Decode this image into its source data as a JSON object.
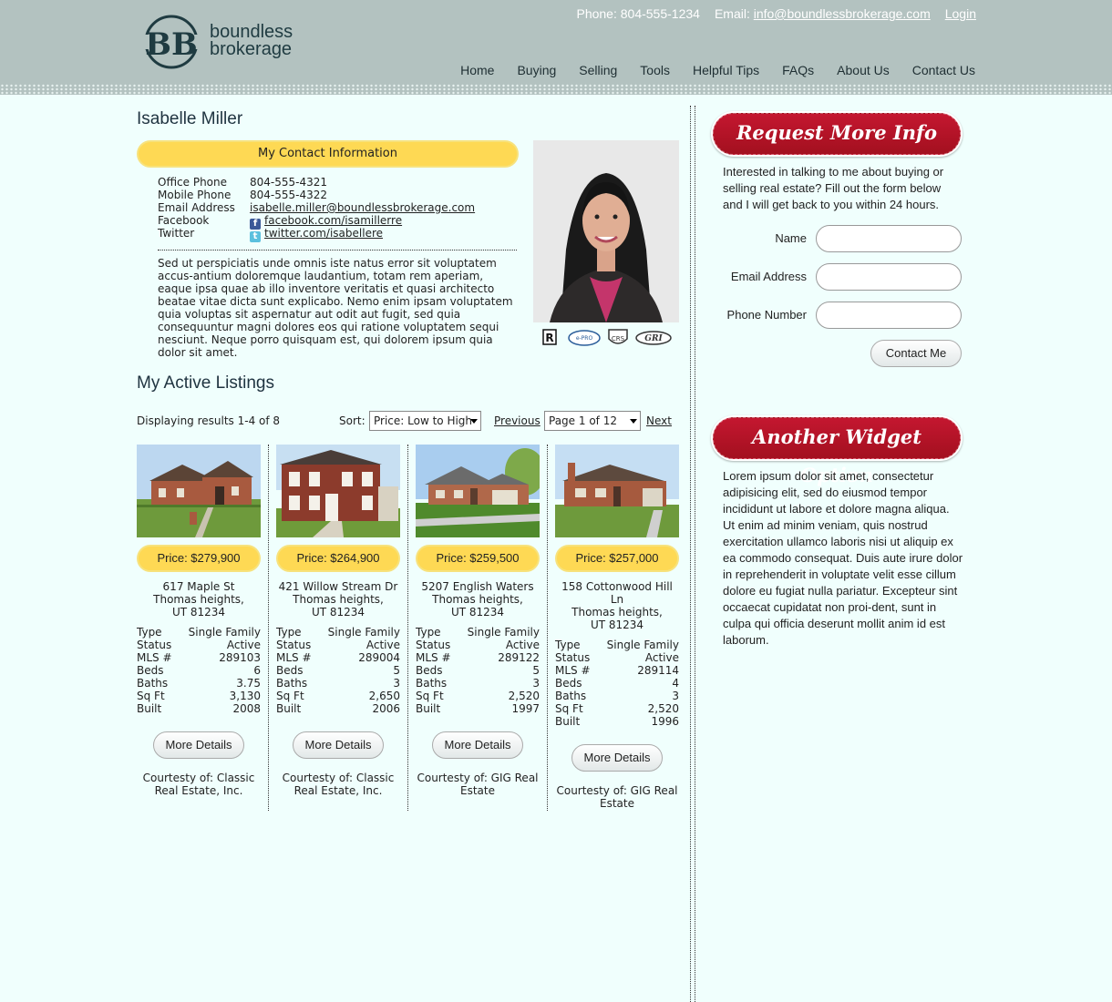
{
  "header": {
    "logo_text_line1": "boundless",
    "logo_text_line2": "brokerage",
    "logo_letters": "BB",
    "phone_label": "Phone:",
    "phone": "804-555-1234",
    "email_label": "Email:",
    "email": "info@boundlessbrokerage.com",
    "login": "Login",
    "nav": [
      "Home",
      "Buying",
      "Selling",
      "Tools",
      "Helpful Tips",
      "FAQs",
      "About Us",
      "Contact Us"
    ]
  },
  "agent": {
    "name": "Isabelle Miller",
    "contact_heading": "My Contact Information",
    "contact": [
      {
        "label": "Office Phone",
        "value": "804-555-4321"
      },
      {
        "label": "Mobile Phone",
        "value": "804-555-4322"
      },
      {
        "label": "Email Address",
        "value": "isabelle.miller@boundlessbrokerage.com"
      },
      {
        "label": "Facebook",
        "value": "facebook.com/isamillerre"
      },
      {
        "label": "Twitter",
        "value": "twitter.com/isabellere"
      }
    ],
    "bio": "Sed ut perspiciatis unde omnis iste natus error sit voluptatem accus-antium doloremque laudantium, totam rem aperiam, eaque ipsa quae ab illo inventore veritatis et quasi architecto beatae vitae dicta sunt explicabo. Nemo enim ipsam voluptatem quia voluptas sit aspernatur aut odit aut fugit, sed quia consequuntur magni dolores eos qui ratione voluptatem sequi nesciunt. Neque porro quisquam est, qui dolorem ipsum quia dolor sit amet.",
    "badges": [
      "R",
      "e-PRO",
      "CRS",
      "GRI"
    ]
  },
  "listings": {
    "title": "My Active Listings",
    "results_text": "Displaying results 1-4 of 8",
    "sort_label": "Sort:",
    "sort_value": "Price: Low to High",
    "previous": "Previous",
    "page_value": "Page 1 of 12",
    "next": "Next",
    "details_label": "More Details",
    "spec_labels": [
      "Type",
      "Status",
      "MLS #",
      "Beds",
      "Baths",
      "Sq Ft",
      "Built"
    ],
    "items": [
      {
        "price": "Price: $279,900",
        "street": "617 Maple St",
        "city": "Thomas heights,",
        "zip": "UT 81234",
        "specs": [
          "Single Family",
          "Active",
          "289103",
          "6",
          "3.75",
          "3,130",
          "2008"
        ],
        "courtesy": "Courtesty of: Classic Real Estate, Inc."
      },
      {
        "price": "Price: $264,900",
        "street": "421 Willow Stream Dr",
        "city": "Thomas heights,",
        "zip": "UT 81234",
        "specs": [
          "Single Family",
          "Active",
          "289004",
          "5",
          "3",
          "2,650",
          "2006"
        ],
        "courtesy": "Courtesty of: Classic Real Estate, Inc."
      },
      {
        "price": "Price: $259,500",
        "street": "5207 English Waters",
        "city": "Thomas heights,",
        "zip": "UT 81234",
        "specs": [
          "Single Family",
          "Active",
          "289122",
          "5",
          "3",
          "2,520",
          "1997"
        ],
        "courtesy": "Courtesty of: GIG Real Estate"
      },
      {
        "price": "Price: $257,000",
        "street": "158 Cottonwood Hill Ln",
        "city": "Thomas heights,",
        "zip": "UT 81234",
        "specs": [
          "Single Family",
          "Active",
          "289114",
          "4",
          "3",
          "2,520",
          "1996"
        ],
        "courtesy": "Courtesty of: GIG Real Estate"
      }
    ]
  },
  "sidebar": {
    "widget1_title": "Request More Info",
    "widget1_text": "Interested in talking to me about buying or selling real estate? Fill out the form below and I will get back to you within 24 hours.",
    "form_name_label": "Name",
    "form_email_label": "Email Address",
    "form_phone_label": "Phone Number",
    "form_submit": "Contact Me",
    "widget2_title": "Another Widget Option",
    "widget2_text": "Lorem ipsum dolor sit amet, consectetur adipisicing elit, sed do eiusmod tempor incididunt ut labore et dolore magna aliqua. Ut enim ad minim veniam, quis nostrud exercitation ullamco laboris nisi ut aliquip ex ea commodo consequat. Duis aute irure dolor in reprehenderit in voluptate velit esse cillum dolore eu fugiat nulla pariatur. Excepteur sint occaecat cupidatat non proi-dent, sunt in culpa qui officia deserunt mollit anim id est laborum."
  },
  "colors": {
    "header_bg": "#b3c2c0",
    "page_bg": "#f0fffd",
    "accent_yellow": "#fed954",
    "widget_red": "#b51326"
  }
}
